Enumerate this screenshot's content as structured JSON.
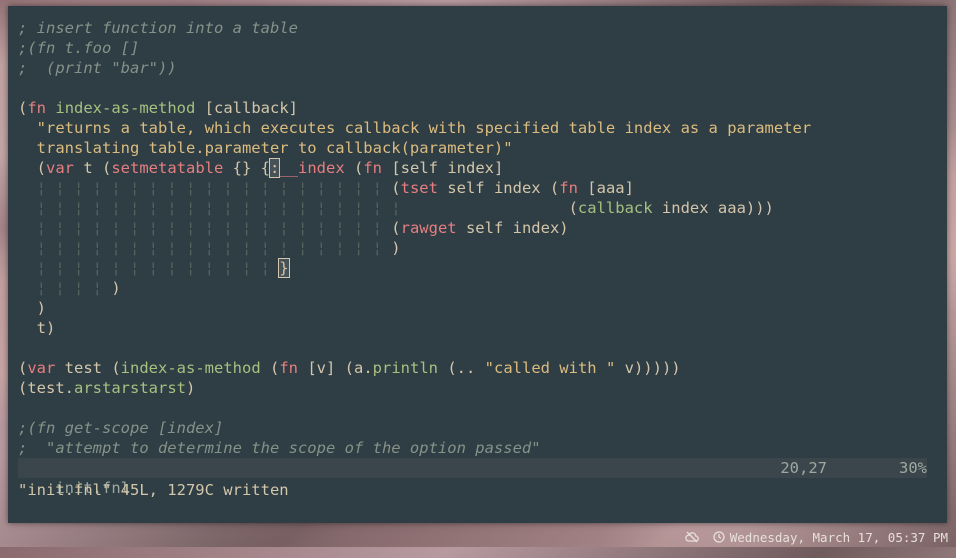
{
  "editor": {
    "lines": [
      [
        {
          "c": "cm",
          "t": "; insert function into a table"
        }
      ],
      [
        {
          "c": "cm",
          "t": ";(fn t.foo []"
        }
      ],
      [
        {
          "c": "cm",
          "t": ";  (print \"bar\"))"
        }
      ],
      [
        {
          "c": "",
          "t": ""
        }
      ],
      [
        {
          "c": "",
          "t": "("
        },
        {
          "c": "kw",
          "t": "fn"
        },
        {
          "c": "",
          "t": " "
        },
        {
          "c": "fn",
          "t": "index-as-method"
        },
        {
          "c": "",
          "t": " [callback]"
        }
      ],
      [
        {
          "c": "",
          "t": "  "
        },
        {
          "c": "st",
          "t": "\"returns a table, which executes callback with specified table index as a parameter"
        }
      ],
      [
        {
          "c": "st",
          "t": "  translating table.parameter to callback(parameter)\""
        }
      ],
      [
        {
          "c": "",
          "t": "  ("
        },
        {
          "c": "kw",
          "t": "var"
        },
        {
          "c": "",
          "t": " t ("
        },
        {
          "c": "kw",
          "t": "setmetatable"
        },
        {
          "c": "",
          "t": " {} {"
        },
        {
          "c": "cur",
          "t": ":"
        },
        {
          "c": "kw",
          "t": "__index"
        },
        {
          "c": "",
          "t": " ("
        },
        {
          "c": "kw",
          "t": "fn"
        },
        {
          "c": "",
          "t": " [self index]"
        }
      ],
      [
        {
          "c": "gd",
          "t": "  ¦ ¦ ¦ ¦ ¦ ¦ ¦ ¦ ¦ ¦ ¦ ¦ ¦ ¦ ¦ ¦ ¦ ¦ ¦ "
        },
        {
          "c": "",
          "t": "("
        },
        {
          "c": "kw",
          "t": "tset"
        },
        {
          "c": "",
          "t": " self index ("
        },
        {
          "c": "kw",
          "t": "fn"
        },
        {
          "c": "",
          "t": " [aaa]"
        }
      ],
      [
        {
          "c": "gd",
          "t": "  ¦ ¦ ¦ ¦ ¦ ¦ ¦ ¦ ¦ ¦ ¦ ¦ ¦ ¦ ¦ ¦ ¦ ¦ ¦ ¦"
        },
        {
          "c": "",
          "t": "                  ("
        },
        {
          "c": "fn",
          "t": "callback"
        },
        {
          "c": "",
          "t": " index aaa)))"
        }
      ],
      [
        {
          "c": "gd",
          "t": "  ¦ ¦ ¦ ¦ ¦ ¦ ¦ ¦ ¦ ¦ ¦ ¦ ¦ ¦ ¦ ¦ ¦ ¦ ¦ "
        },
        {
          "c": "",
          "t": "("
        },
        {
          "c": "kw",
          "t": "rawget"
        },
        {
          "c": "",
          "t": " self index)"
        }
      ],
      [
        {
          "c": "gd",
          "t": "  ¦ ¦ ¦ ¦ ¦ ¦ ¦ ¦ ¦ ¦ ¦ ¦ ¦ ¦ ¦ ¦ ¦ ¦ ¦ "
        },
        {
          "c": "",
          "t": ")"
        }
      ],
      [
        {
          "c": "gd",
          "t": "  ¦ ¦ ¦ ¦ ¦ ¦ ¦ ¦ ¦ ¦ ¦ ¦ ¦ "
        },
        {
          "c": "cur",
          "t": "}"
        }
      ],
      [
        {
          "c": "gd",
          "t": "  ¦ ¦ ¦ ¦ "
        },
        {
          "c": "",
          "t": ")"
        }
      ],
      [
        {
          "c": "",
          "t": "  )"
        }
      ],
      [
        {
          "c": "",
          "t": "  t)"
        }
      ],
      [
        {
          "c": "",
          "t": ""
        }
      ],
      [
        {
          "c": "",
          "t": "("
        },
        {
          "c": "kw",
          "t": "var"
        },
        {
          "c": "",
          "t": " test ("
        },
        {
          "c": "fn",
          "t": "index-as-method"
        },
        {
          "c": "",
          "t": " ("
        },
        {
          "c": "kw",
          "t": "fn"
        },
        {
          "c": "",
          "t": " [v] (a."
        },
        {
          "c": "fn",
          "t": "println"
        },
        {
          "c": "",
          "t": " (.. "
        },
        {
          "c": "st",
          "t": "\"called with \""
        },
        {
          "c": "",
          "t": " v)))))"
        }
      ],
      [
        {
          "c": "",
          "t": "(test."
        },
        {
          "c": "fn",
          "t": "arstarstarst"
        },
        {
          "c": "",
          "t": ")"
        }
      ],
      [
        {
          "c": "",
          "t": ""
        }
      ],
      [
        {
          "c": "cm",
          "t": ";(fn get-scope [index]"
        }
      ],
      [
        {
          "c": "cm",
          "t": ";  \"attempt to determine the scope of the option passed\""
        }
      ]
    ]
  },
  "statusline": {
    "filename": "init.fnl",
    "position": "20,27",
    "percent": "30%"
  },
  "message": "\"init.fnl\" 45L, 1279C written",
  "taskbar": {
    "weather_icon": "cloud-off-icon",
    "clock_icon": "clock-icon",
    "datetime": "Wednesday, March 17, 05:37 PM"
  }
}
